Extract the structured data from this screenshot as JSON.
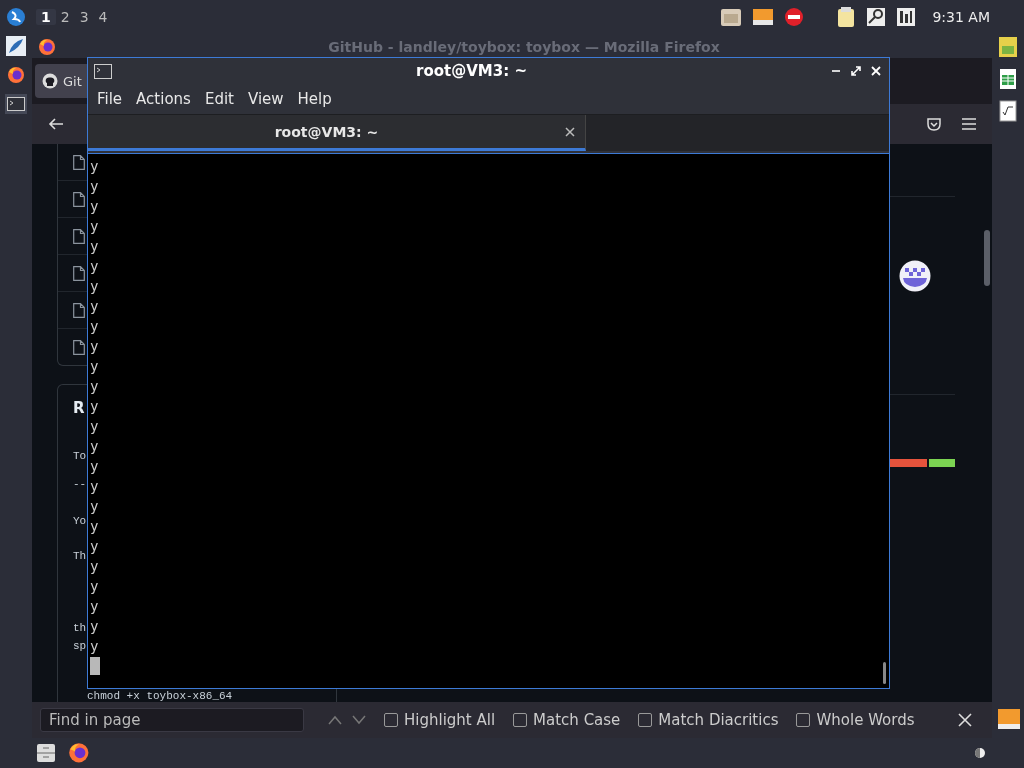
{
  "panel": {
    "workspaces": [
      {
        "label": "1",
        "selected": true
      },
      {
        "label": "2",
        "selected": false
      },
      {
        "label": "3",
        "selected": false
      },
      {
        "label": "4",
        "selected": false
      }
    ],
    "clock": "9:31 AM"
  },
  "firefox": {
    "title": "GitHub - landley/toybox: toybox — Mozilla Firefox",
    "active": false,
    "tab": "Git",
    "readme_heading": "R",
    "readme_fragments": [
      "To",
      "--",
      "Yo",
      "Th",
      "th",
      "sp"
    ],
    "code_line": "chmod +x toybox-x86_64",
    "find_bar": {
      "placeholder": "Find in page",
      "options": [
        {
          "label": "Highlight All",
          "checked": false
        },
        {
          "label": "Match Case",
          "checked": false
        },
        {
          "label": "Match Diacritics",
          "checked": false
        },
        {
          "label": "Whole Words",
          "checked": false
        }
      ]
    }
  },
  "terminal": {
    "title": "root@VM3: ~",
    "active": true,
    "menu": [
      "File",
      "Actions",
      "Edit",
      "View",
      "Help"
    ],
    "tabs": [
      {
        "label": "root@VM3: ~",
        "selected": true
      }
    ],
    "lines": [
      "y",
      "y",
      "y",
      "y",
      "y",
      "y",
      "y",
      "y",
      "y",
      "y",
      "y",
      "y",
      "y",
      "y",
      "y",
      "y",
      "y",
      "y",
      "y",
      "y",
      "y",
      "y",
      "y",
      "y",
      "y"
    ]
  }
}
